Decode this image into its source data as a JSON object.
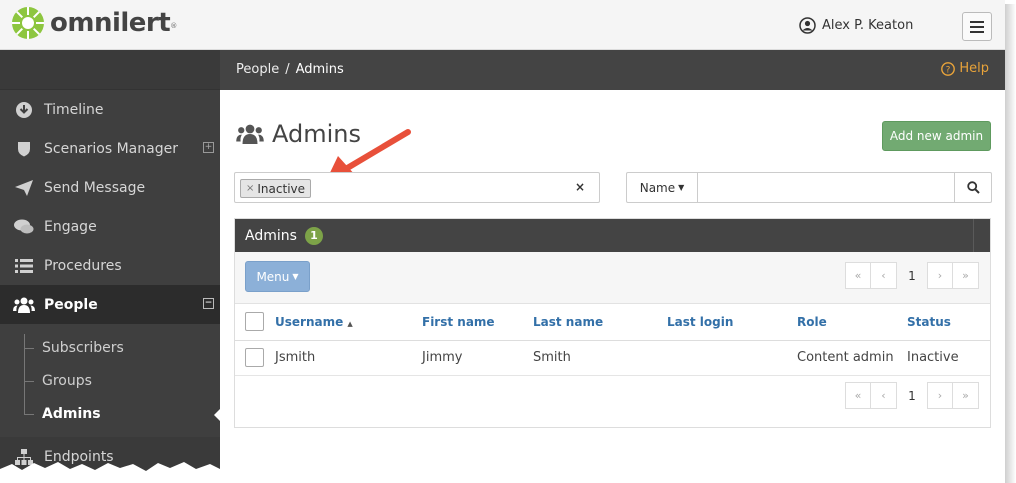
{
  "app": {
    "logo_text": "omnilert",
    "logo_mark": "®"
  },
  "header": {
    "user_name": "Alex P. Keaton"
  },
  "sidebar": {
    "items": [
      {
        "label": "Timeline",
        "icon": "arrow-down-circle-icon"
      },
      {
        "label": "Scenarios Manager",
        "icon": "shield-icon",
        "expander": "⊞"
      },
      {
        "label": "Send Message",
        "icon": "paper-plane-icon"
      },
      {
        "label": "Engage",
        "icon": "chat-bubbles-icon"
      },
      {
        "label": "Procedures",
        "icon": "list-icon"
      },
      {
        "label": "People",
        "icon": "users-icon",
        "expander": "⊟"
      }
    ],
    "sub_items": [
      {
        "label": "Subscribers"
      },
      {
        "label": "Groups"
      },
      {
        "label": "Admins"
      }
    ],
    "endpoints": {
      "label": "Endpoints",
      "icon": "sitemap-icon"
    }
  },
  "breadcrumb": {
    "parent": "People",
    "separator": "/",
    "current": "Admins"
  },
  "help": {
    "label": "Help"
  },
  "page": {
    "title": "Admins",
    "add_button": "Add new admin"
  },
  "filter": {
    "chip_label": "Inactive",
    "chip_remove": "×",
    "clear": "×"
  },
  "search": {
    "field_label": "Name",
    "placeholder": ""
  },
  "panel": {
    "title": "Admins",
    "count": "1",
    "menu_label": "Menu",
    "pagination": {
      "first": "«",
      "prev": "‹",
      "page": "1",
      "next": "›",
      "last": "»"
    }
  },
  "table": {
    "columns": [
      "Username",
      "First name",
      "Last name",
      "Last login",
      "Role",
      "Status"
    ],
    "sort_indicator": "▲",
    "rows": [
      {
        "username": "Jsmith",
        "first_name": "Jimmy",
        "last_name": "Smith",
        "last_login": "",
        "role": "Content admin",
        "status": "Inactive"
      }
    ]
  },
  "colors": {
    "topbar": "#f5f5f5",
    "sidebar": "#3f3f3f",
    "breadcrumb_bar": "#444444",
    "add_button": "#72aa72",
    "menu_button": "#8cb0d8",
    "badge": "#7da348",
    "help": "#e8a33a",
    "column_header": "#3370a8",
    "annotation_arrow": "#e8503a"
  }
}
